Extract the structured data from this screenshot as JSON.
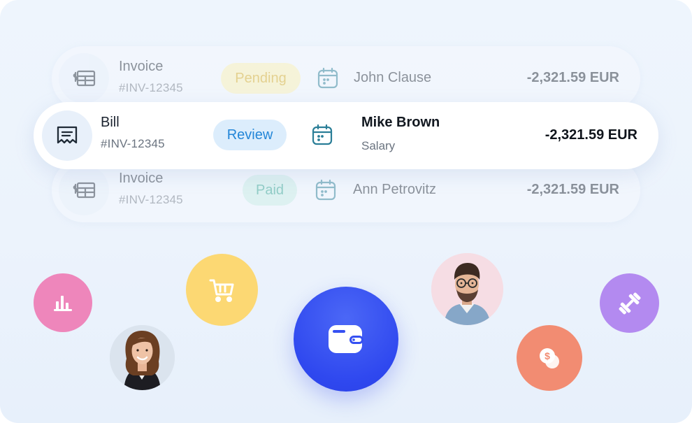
{
  "transactions": [
    {
      "doc_type": "Invoice",
      "doc_id": "#INV-12345",
      "status": "Pending",
      "name": "John Clause",
      "amount": "-2,321.59 EUR",
      "state": "faded"
    },
    {
      "doc_type": "Bill",
      "doc_id": "#INV-12345",
      "status": "Review",
      "name": "Mike Brown",
      "category": "Salary",
      "amount": "-2,321.59 EUR",
      "state": "active"
    },
    {
      "doc_type": "Invoice",
      "doc_id": "#INV-12345",
      "status": "Paid",
      "name": "Ann Petrovitz",
      "amount": "-2,321.59 EUR",
      "state": "faded"
    }
  ],
  "bubbles": [
    {
      "icon": "bar-chart-icon",
      "color": "#ee86bb"
    },
    {
      "icon": "shopping-cart-icon",
      "color": "#fcd873"
    },
    {
      "icon": "wallet-icon",
      "color": "#3550f2"
    },
    {
      "icon": "dollar-coins-icon",
      "color": "#f28c72"
    },
    {
      "icon": "dumbbell-icon",
      "color": "#b38af0"
    }
  ],
  "avatars": [
    {
      "icon": "woman-avatar"
    },
    {
      "icon": "man-avatar"
    }
  ],
  "colors": {
    "pending_bg": "#fbf1b4",
    "pending_text": "#d7ab1c",
    "review_bg": "#dcedfc",
    "review_text": "#2386d8",
    "paid_bg": "#c9ece6",
    "paid_text": "#2ca18d",
    "calendar_active": "#2a7e97"
  }
}
